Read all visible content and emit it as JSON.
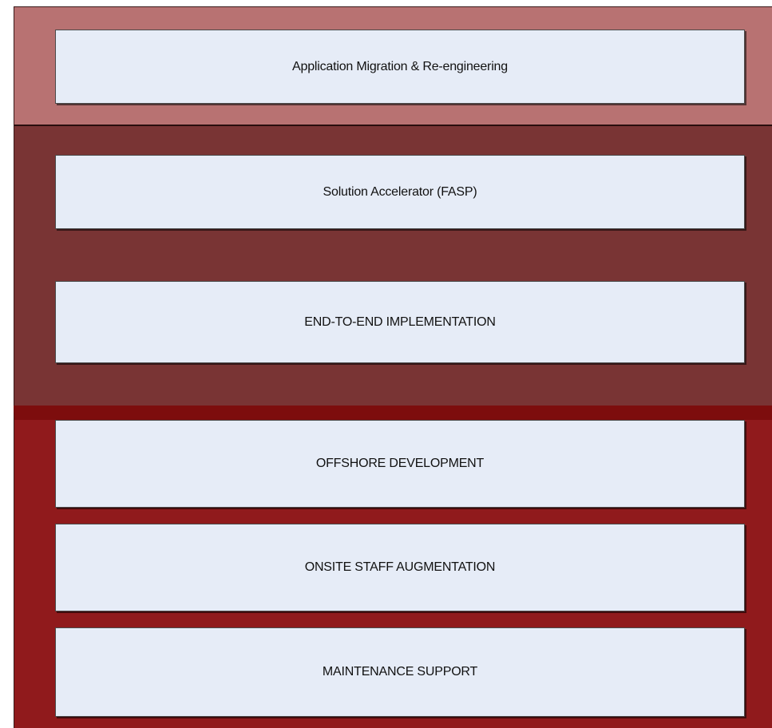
{
  "colors": {
    "tier_top": "#b87272",
    "tier_middle": "#793434",
    "tier_bottom": "#901a1c",
    "box_fill": "#e6ecf7"
  },
  "tiers": [
    {
      "items": [
        "Application Migration & Re-engineering"
      ]
    },
    {
      "items": [
        "Solution Accelerator (FASP)",
        "END-TO-END IMPLEMENTATION"
      ]
    },
    {
      "items": [
        "OFFSHORE DEVELOPMENT",
        "ONSITE STAFF AUGMENTATION",
        "MAINTENANCE SUPPORT"
      ]
    }
  ]
}
